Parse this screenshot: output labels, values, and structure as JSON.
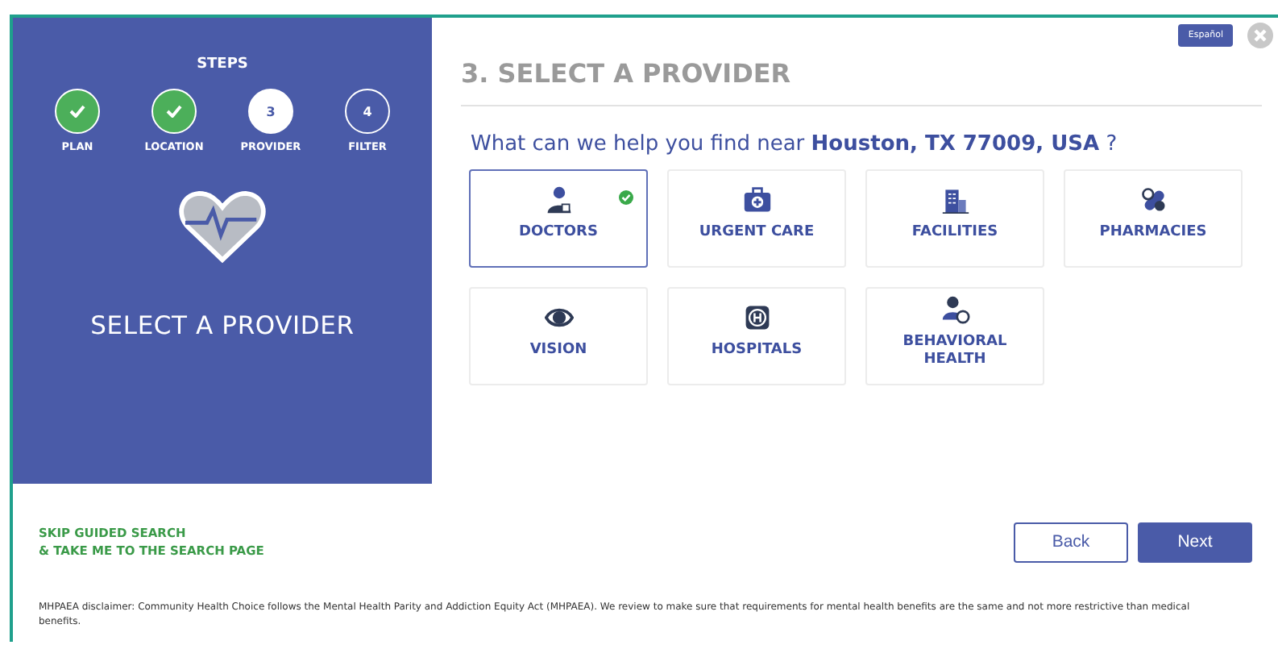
{
  "language_button": "Español",
  "steps_panel": {
    "title": "STEPS",
    "heading": "SELECT A PROVIDER",
    "steps": [
      {
        "label": "PLAN",
        "done": true,
        "selected": false
      },
      {
        "label": "LOCATION",
        "done": true,
        "selected": false
      },
      {
        "number": "3",
        "label": "PROVIDER",
        "done": false,
        "selected": true
      },
      {
        "number": "4",
        "label": "FILTER",
        "done": false,
        "selected": false
      }
    ]
  },
  "page_title": "3. SELECT A PROVIDER",
  "question": "What can we help you find near **Houston, TX 77009, USA** ?",
  "provider_types": [
    {
      "label": "DOCTORS",
      "kind": "doctor",
      "selected": true
    },
    {
      "label": "URGENT CARE",
      "kind": "kit",
      "selected": false
    },
    {
      "label": "FACILITIES",
      "kind": "building",
      "selected": false
    },
    {
      "label": "PHARMACIES",
      "kind": "pill",
      "selected": false
    },
    {
      "label": "VISION",
      "kind": "eye",
      "selected": false
    },
    {
      "label": "HOSPITALS",
      "kind": "hospital",
      "selected": false
    },
    {
      "label": "BEHAVIORAL HEALTH",
      "kind": "person",
      "selected": false
    }
  ],
  "skip_link": [
    "SKIP GUIDED SEARCH",
    "& TAKE ME TO THE SEARCH PAGE"
  ],
  "buttons": {
    "back": "Back",
    "next": "Next"
  },
  "disclaimer": "MHPAEA disclaimer: Community Health Choice follows the Mental Health Parity and Addiction Equity Act (MHPAEA). We review to make sure that requirements for mental health benefits are the same and not more restrictive than medical benefits."
}
